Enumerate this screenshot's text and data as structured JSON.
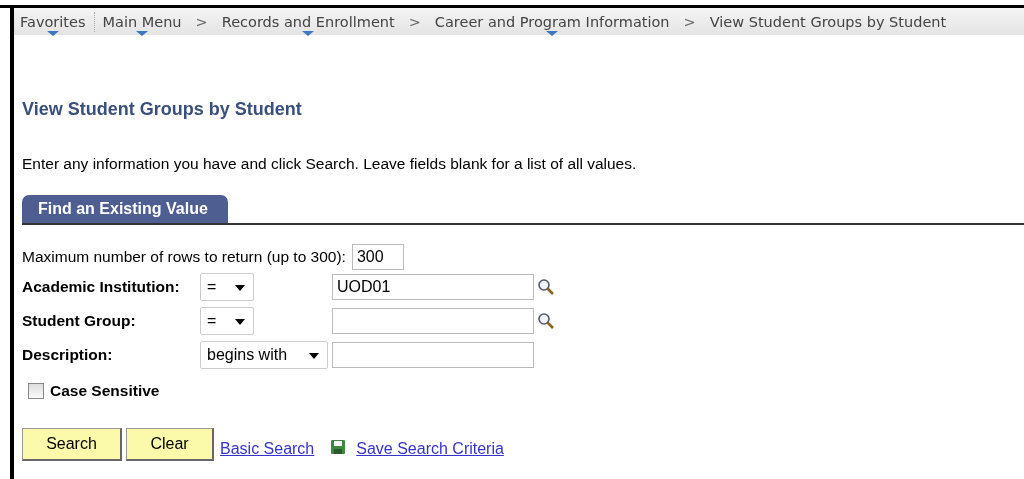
{
  "breadcrumb": {
    "favorites": {
      "label": "Favorites",
      "has_menu": true
    },
    "separator": ">",
    "items": [
      {
        "label": "Main Menu",
        "has_menu": true
      },
      {
        "label": "Records and Enrollment",
        "has_menu": true
      },
      {
        "label": "Career and Program Information",
        "has_menu": true
      },
      {
        "label": "View Student Groups by Student",
        "has_menu": false
      }
    ]
  },
  "page_title": "View Student Groups by Student",
  "instructions": "Enter any information you have and click Search. Leave fields blank for a list of all values.",
  "tabs": [
    {
      "label": "Find an Existing Value",
      "selected": true
    }
  ],
  "max_rows": {
    "label": "Maximum number of rows to return (up to 300):",
    "value": "300"
  },
  "fields": [
    {
      "label": "Academic Institution:",
      "operator": "=",
      "value": "UOD01",
      "lookup": true
    },
    {
      "label": "Student Group:",
      "operator": "=",
      "lookup": true
    },
    {
      "label": "Description:",
      "operator": "begins with",
      "lookup": false
    }
  ],
  "case_sensitive": {
    "label": "Case Sensitive",
    "checked": false
  },
  "buttons": [
    "Search",
    "Clear"
  ],
  "links": [
    {
      "label": "Basic Search",
      "icon": false
    },
    {
      "label": "Save Search Criteria",
      "icon": true
    }
  ]
}
